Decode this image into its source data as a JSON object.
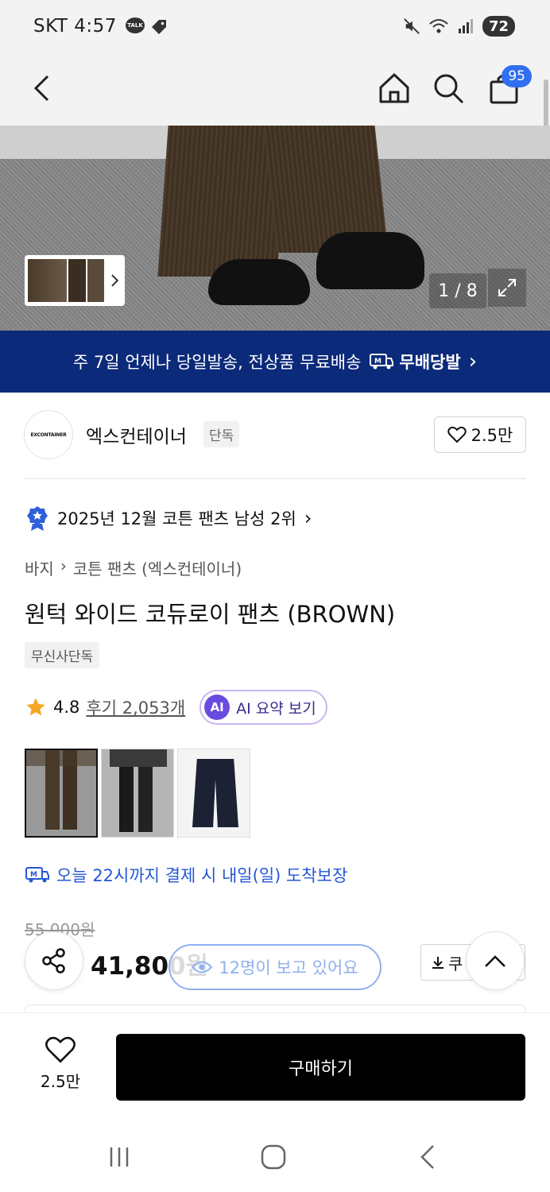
{
  "status_bar": {
    "carrier_time": "SKT 4:57",
    "talk_label": "TALK",
    "battery": "72"
  },
  "header": {
    "icons": [
      "back-icon",
      "home-icon",
      "search-icon",
      "cart-icon"
    ],
    "cart_count": "95"
  },
  "hero": {
    "counter": "1 / 8"
  },
  "promo": {
    "text": "주 7일 언제나 당일발송, 전상품 무료배송",
    "brand": "무배당발",
    "chevron": "›"
  },
  "brand": {
    "logo_text": "EXCONTAINER",
    "name": "엑스컨테이너",
    "tag": "단독",
    "likes": "2.5만"
  },
  "ranking": {
    "text": "2025년 12월 코튼 팬츠 남성 2위",
    "chevron": "›"
  },
  "breadcrumb": {
    "items": [
      "바지",
      "›",
      "코튼 팬츠 (엑스컨테이너)"
    ]
  },
  "product": {
    "title": "원턱 와이드 코듀로이 팬츠 (BROWN)",
    "tag": "무신사단독",
    "rating": "4.8",
    "reviews": "후기 2,053개",
    "ai_badge": "AI",
    "ai_label": "AI 요약 보기"
  },
  "delivery": {
    "text": "오늘 22시까지 결제 시 내일(일) 도착보장"
  },
  "price": {
    "original": "55,000원",
    "sale": "41,800원",
    "viewers": "12명이 보고 있어요",
    "coupon": "쿠"
  },
  "bottom": {
    "wish_count": "2.5만",
    "buy_label": "구매하기"
  },
  "colors": {
    "banner": "#0c2a7a",
    "accent_blue": "#2457d6",
    "ai_purple": "#6a4be0",
    "badge_blue": "#2f6ff0",
    "star": "#f5a623"
  }
}
